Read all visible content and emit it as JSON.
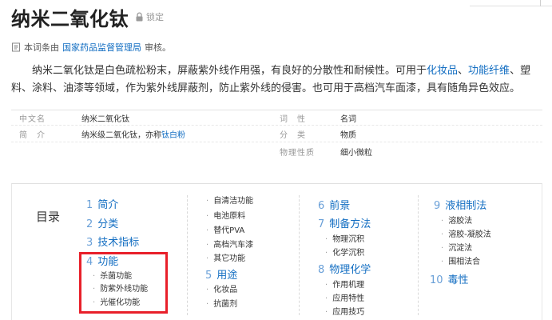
{
  "page": {
    "title": "纳米二氧化钛",
    "lock_label": "锁定"
  },
  "review": {
    "prefix": "本词条由",
    "agency": "国家药品监督管理局",
    "suffix": "审核。"
  },
  "summary": {
    "part1": "纳米二氧化钛是白色疏松粉末，屏蔽紫外线作用强，有良好的分散性和耐候性。可用于",
    "link1": "化妆品",
    "sep1": "、",
    "link2": "功能纤维",
    "part2": "、塑料、涂料、油漆等领域，作为紫外线屏蔽剂，防止紫外线的侵害。也可用于高档汽车面漆，具有随角异色效应。"
  },
  "basic_info": {
    "left": [
      {
        "name": "中文名",
        "value": "纳米二氧化钛",
        "value_link": ""
      },
      {
        "name": "简　介",
        "value": "纳米级二氧化钛，亦称",
        "value_link": "钛白粉"
      }
    ],
    "right": [
      {
        "name": "词　性",
        "value": "名词"
      },
      {
        "name": "分　类",
        "value": "物质"
      },
      {
        "name": "物理性质",
        "value": "细小微粒"
      }
    ]
  },
  "toc": {
    "label": "目录",
    "col1": [
      {
        "num": "1",
        "label": "简介"
      },
      {
        "num": "2",
        "label": "分类"
      },
      {
        "num": "3",
        "label": "技术指标"
      },
      {
        "num": "4",
        "label": "功能"
      }
    ],
    "col1_subs": [
      "杀菌功能",
      "防紫外线功能",
      "光催化功能"
    ],
    "col2_subs_top": [
      "自清洁功能",
      "电池原料",
      "替代PVA",
      "高档汽车漆",
      "其它功能"
    ],
    "col2_l1": {
      "num": "5",
      "label": "用途"
    },
    "col2_subs_bottom": [
      "化妆品",
      "抗菌剂"
    ],
    "col3_a": {
      "num": "6",
      "label": "前景"
    },
    "col3_b": {
      "num": "7",
      "label": "制备方法"
    },
    "col3_b_subs": [
      "物理沉积",
      "化学沉积"
    ],
    "col3_c": {
      "num": "8",
      "label": "物理化学"
    },
    "col3_c_subs": [
      "作用机理",
      "应用特性",
      "应用技巧"
    ],
    "col4_a": {
      "num": "9",
      "label": "液相制法"
    },
    "col4_a_subs": [
      "溶胶法",
      "溶胶-凝胶法",
      "沉淀法",
      "围相法合"
    ],
    "col4_b": {
      "num": "10",
      "label": "毒性"
    }
  },
  "colors": {
    "link": "#136ec2",
    "highlight": "#e8202a"
  }
}
